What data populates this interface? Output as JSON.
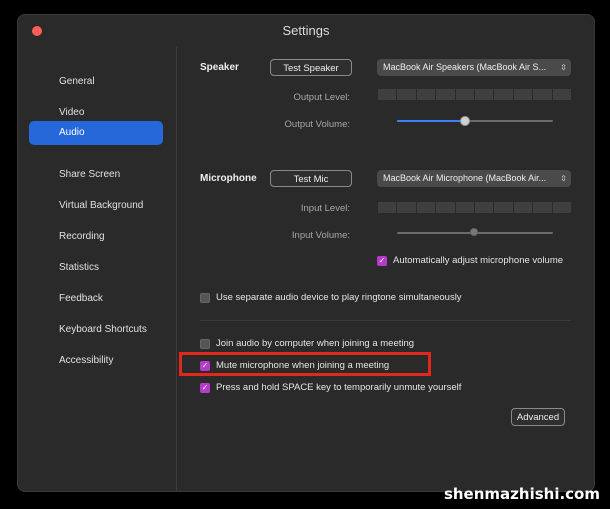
{
  "window": {
    "title": "Settings"
  },
  "sidebar": {
    "items": [
      {
        "label": "General"
      },
      {
        "label": "Video"
      },
      {
        "label": "Audio",
        "active": true
      },
      {
        "label": "Share Screen"
      },
      {
        "label": "Virtual Background"
      },
      {
        "label": "Recording"
      },
      {
        "label": "Statistics"
      },
      {
        "label": "Feedback"
      },
      {
        "label": "Keyboard Shortcuts"
      },
      {
        "label": "Accessibility"
      }
    ]
  },
  "speaker": {
    "heading": "Speaker",
    "test_button": "Test Speaker",
    "device": "MacBook Air Speakers (MacBook Air S...",
    "output_level_label": "Output Level:",
    "output_volume_label": "Output Volume:",
    "volume_level": 0.5
  },
  "microphone": {
    "heading": "Microphone",
    "test_button": "Test Mic",
    "device": "MacBook Air Microphone (MacBook Air...",
    "input_level_label": "Input Level:",
    "input_volume_label": "Input Volume:",
    "volume_level": 0.5,
    "auto_adjust_label": "Automatically adjust microphone volume",
    "auto_adjust_checked": true
  },
  "options": {
    "separate_device_label": "Use separate audio device to play ringtone simultaneously",
    "separate_device_checked": false,
    "join_audio_label": "Join audio by computer when joining a meeting",
    "join_audio_checked": false,
    "mute_label": "Mute microphone when joining a meeting",
    "mute_checked": true,
    "space_label": "Press and hold SPACE key to temporarily unmute yourself",
    "space_checked": true
  },
  "advanced_button": "Advanced",
  "watermark": "shenmazhishi.com",
  "colors": {
    "accent": "#2667d9",
    "checkbox": "#b53ac9",
    "highlight": "#e0281c"
  },
  "icons": {
    "checkbox": "checkmark-icon",
    "select": "up-down-chevron-icon"
  }
}
